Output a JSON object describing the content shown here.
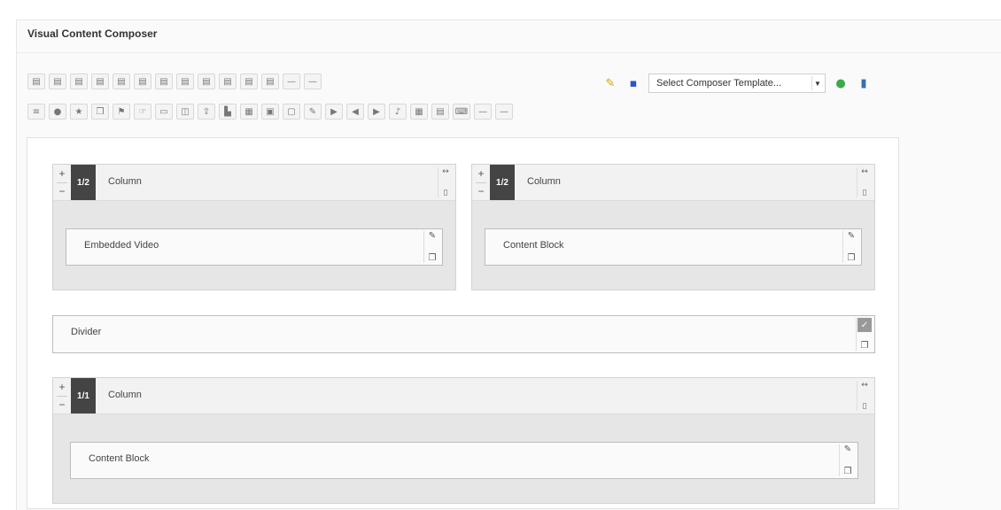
{
  "panel": {
    "title": "Visual Content Composer"
  },
  "toolbar_row1": {
    "items": [
      {
        "icon": "image-icon",
        "glyph": "▤"
      },
      {
        "icon": "image-icon",
        "glyph": "▤"
      },
      {
        "icon": "image-icon",
        "glyph": "▤"
      },
      {
        "icon": "image-icon",
        "glyph": "▤"
      },
      {
        "icon": "image-icon",
        "glyph": "▤"
      },
      {
        "icon": "image-icon",
        "glyph": "▤"
      },
      {
        "icon": "image-icon",
        "glyph": "▤"
      },
      {
        "icon": "image-icon",
        "glyph": "▤"
      },
      {
        "icon": "image-icon",
        "glyph": "▤"
      },
      {
        "icon": "image-icon",
        "glyph": "▤"
      },
      {
        "icon": "image-icon",
        "glyph": "▤"
      },
      {
        "icon": "image-icon",
        "glyph": "▤"
      },
      {
        "icon": "dash-icon",
        "glyph": "—"
      },
      {
        "icon": "dash-icon",
        "glyph": "—"
      }
    ]
  },
  "toolbar_row2": {
    "items": [
      {
        "icon": "list-icon",
        "glyph": "≡"
      },
      {
        "icon": "circle-icon",
        "glyph": "●"
      },
      {
        "icon": "star-icon",
        "glyph": "★"
      },
      {
        "icon": "layers-icon",
        "glyph": "❐"
      },
      {
        "icon": "flag-icon",
        "glyph": "⚑"
      },
      {
        "icon": "pointer-icon",
        "glyph": "☞"
      },
      {
        "icon": "box-icon",
        "glyph": "▭"
      },
      {
        "icon": "panel-icon",
        "glyph": "◫"
      },
      {
        "icon": "upload-icon",
        "glyph": "⇪"
      },
      {
        "icon": "chart-icon",
        "glyph": "▙"
      },
      {
        "icon": "film-icon",
        "glyph": "▦"
      },
      {
        "icon": "doc-icon",
        "glyph": "▣"
      },
      {
        "icon": "window-icon",
        "glyph": "▢"
      },
      {
        "icon": "edit-icon",
        "glyph": "✎"
      },
      {
        "icon": "video-icon",
        "glyph": "▶"
      },
      {
        "icon": "audio-icon",
        "glyph": "◀"
      },
      {
        "icon": "video-icon",
        "glyph": "▶"
      },
      {
        "icon": "note-icon",
        "glyph": "♪"
      },
      {
        "icon": "grid-icon",
        "glyph": "▦"
      },
      {
        "icon": "table-icon",
        "glyph": "▤"
      },
      {
        "icon": "code-icon",
        "glyph": "⌨"
      },
      {
        "icon": "dash-icon",
        "glyph": "—"
      },
      {
        "icon": "dash-icon",
        "glyph": "—"
      }
    ]
  },
  "right_tools": {
    "paint_icon": "✎",
    "save_icon": "▪",
    "template_select": "Select Composer Template...",
    "add_icon": "●",
    "delete_icon": "▮"
  },
  "rows": {
    "col_a": {
      "badge": "1/2",
      "label": "Column",
      "block": "Embedded Video"
    },
    "col_b": {
      "badge": "1/2",
      "label": "Column",
      "block": "Content Block"
    },
    "divider": {
      "label": "Divider"
    },
    "col_c": {
      "badge": "1/1",
      "label": "Column",
      "block": "Content Block"
    }
  },
  "glyphs": {
    "plus": "+",
    "minus": "−",
    "arrows": "↔",
    "trash": "▯",
    "pencil": "✎",
    "copy": "❐",
    "check": "✓"
  },
  "colors": {
    "badge_bg": "#444444",
    "paint_icon": "#d4a300",
    "save_icon": "#2a56c6",
    "add_icon": "#3bab4a",
    "delete_icon": "#3a6cb0"
  }
}
